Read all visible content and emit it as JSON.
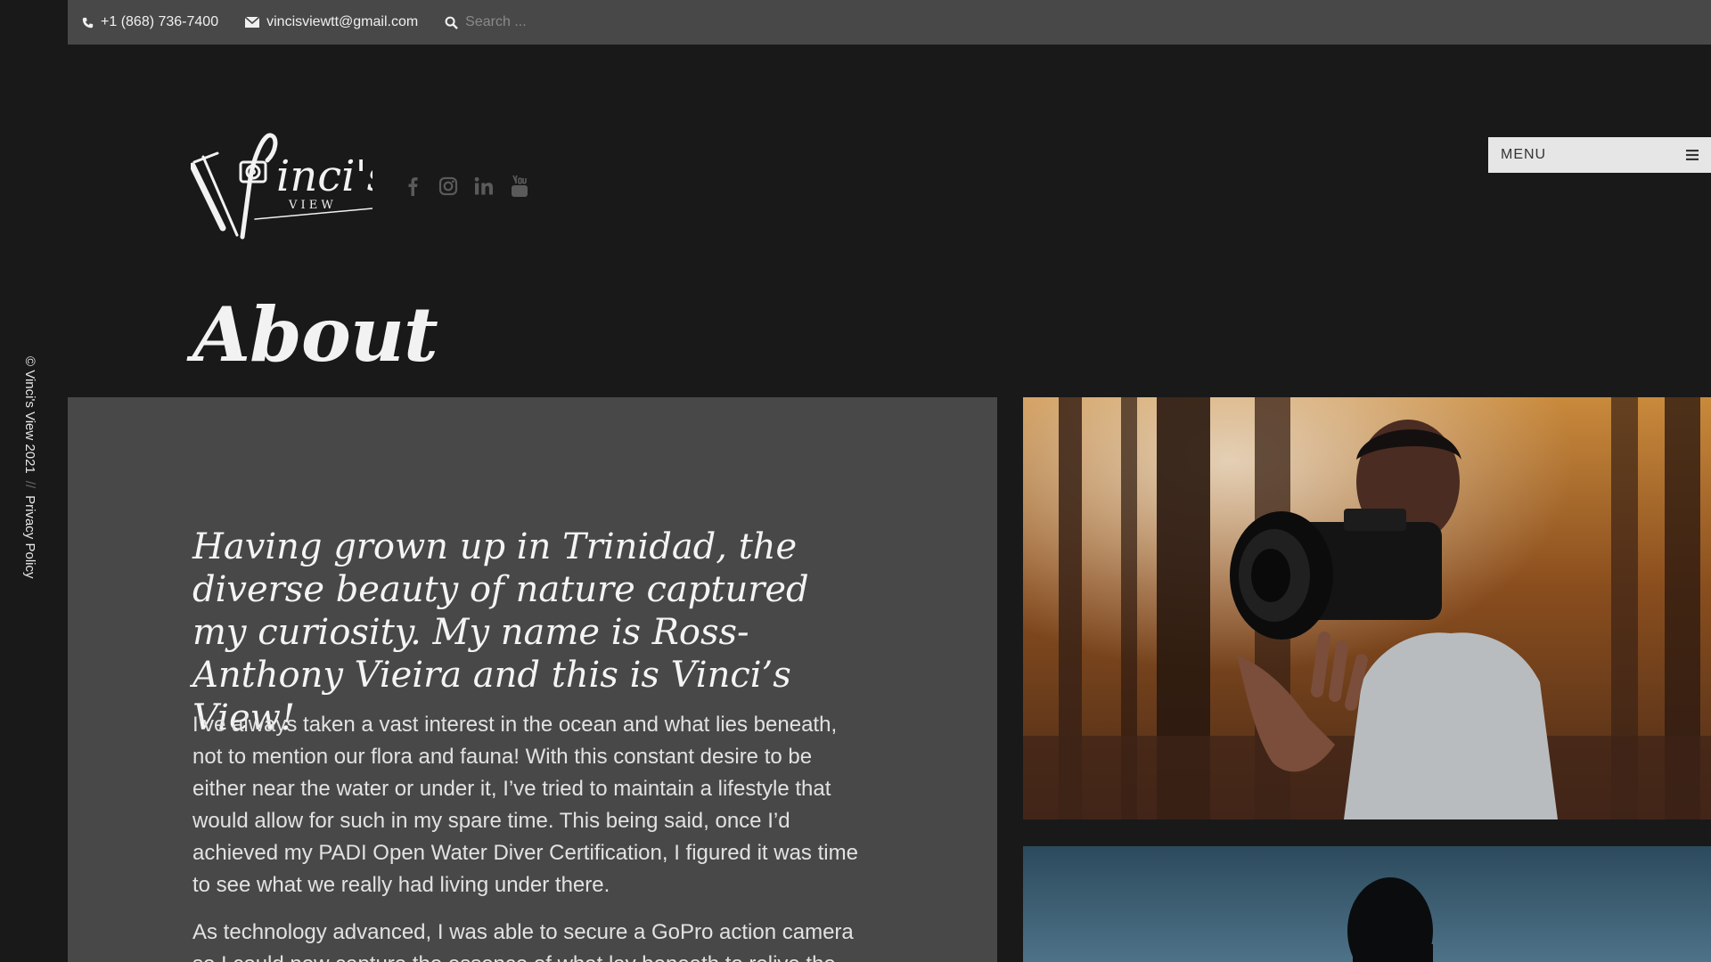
{
  "topbar": {
    "phone": "+1 (868) 736-7400",
    "email": "vincisviewtt@gmail.com",
    "search_placeholder": "Search ..."
  },
  "logo": {
    "text_main": "inci's",
    "text_sub": "V I E W"
  },
  "socials": [
    "facebook-icon",
    "instagram-icon",
    "linkedin-icon",
    "youtube-icon"
  ],
  "menu": {
    "label": "MENU"
  },
  "sidebar": {
    "copyright": "© Vinci's View 2021",
    "separator": "//",
    "privacy": "Privacy Policy"
  },
  "page": {
    "title": "About",
    "intro": "Having grown up in Trinidad, the diverse beauty of nature captured my curiosity. My name is Ross-Anthony Vieira and this is Vinci’s View!",
    "paragraphs": [
      "I’ve always taken a vast interest in the ocean and what lies beneath, not to mention our flora and fauna! With this constant desire to be either near the water or under it, I’ve tried to maintain a lifestyle that would allow for such in my spare time. This being said, once I’d achieved my PADI Open Water Diver Certification, I figured it was time to see what we really had living under there.",
      "As technology advanced, I was able to secure a GoPro action camera so I could now capture the essence of what lay beneath to relive the"
    ]
  },
  "colors": {
    "background": "#191919",
    "topbar": "#484848",
    "panel": "#484848",
    "menu_bg": "#e6e6e6"
  }
}
